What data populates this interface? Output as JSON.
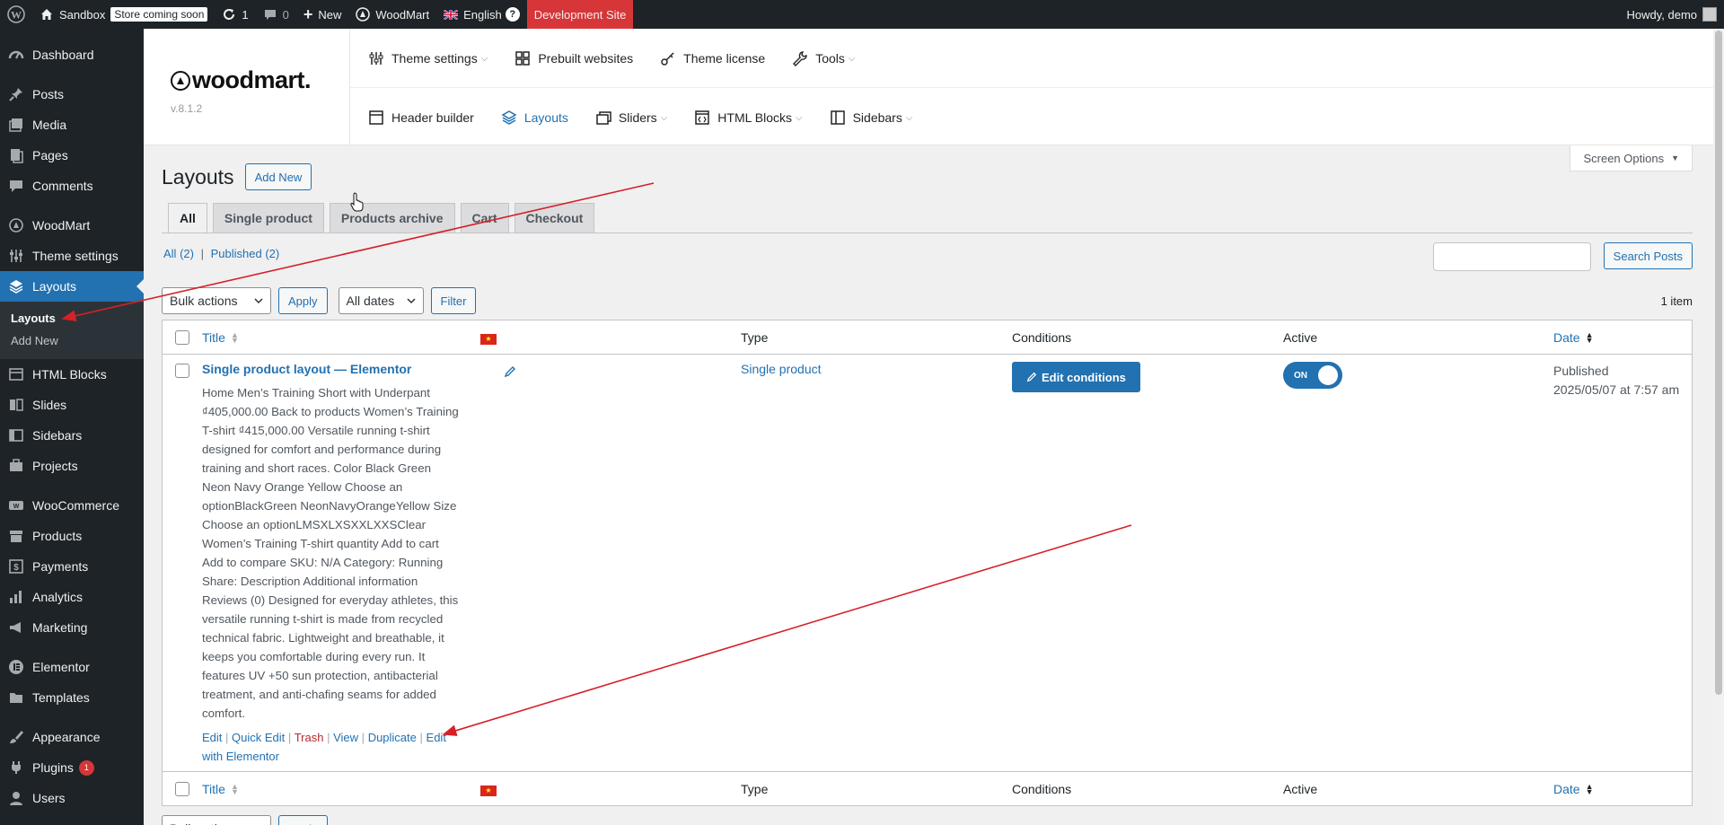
{
  "adminbar": {
    "site_name": "Sandbox",
    "store_badge": "Store coming soon",
    "updates_count": "1",
    "comments_count": "0",
    "new_label": "New",
    "woodmart_label": "WoodMart",
    "language_label": "English",
    "help_label": "?",
    "dev_site_label": "Development Site",
    "howdy_label": "Howdy, demo"
  },
  "sidebar": {
    "items": [
      {
        "label": "Dashboard"
      },
      {
        "label": "Posts"
      },
      {
        "label": "Media"
      },
      {
        "label": "Pages"
      },
      {
        "label": "Comments"
      },
      {
        "label": "WoodMart"
      },
      {
        "label": "Theme settings"
      },
      {
        "label": "Layouts"
      },
      {
        "label": "HTML Blocks"
      },
      {
        "label": "Slides"
      },
      {
        "label": "Sidebars"
      },
      {
        "label": "Projects"
      },
      {
        "label": "WooCommerce"
      },
      {
        "label": "Products"
      },
      {
        "label": "Payments"
      },
      {
        "label": "Analytics"
      },
      {
        "label": "Marketing"
      },
      {
        "label": "Elementor"
      },
      {
        "label": "Templates"
      },
      {
        "label": "Appearance"
      },
      {
        "label": "Plugins"
      },
      {
        "label": "Users"
      }
    ],
    "submenu": {
      "current": "Layouts",
      "add_new": "Add New"
    },
    "plugins_badge": "1"
  },
  "woodmart": {
    "logo_text": "woodmart.",
    "version": "v.8.1.2",
    "nav_row1": [
      {
        "label": "Theme settings"
      },
      {
        "label": "Prebuilt websites"
      },
      {
        "label": "Theme license"
      },
      {
        "label": "Tools"
      }
    ],
    "nav_row2": [
      {
        "label": "Header builder"
      },
      {
        "label": "Layouts"
      },
      {
        "label": "Sliders"
      },
      {
        "label": "HTML Blocks"
      },
      {
        "label": "Sidebars"
      }
    ]
  },
  "page": {
    "screen_options": "Screen Options",
    "title": "Layouts",
    "add_new": "Add New",
    "tabs": [
      {
        "label": "All"
      },
      {
        "label": "Single product"
      },
      {
        "label": "Products archive"
      },
      {
        "label": "Cart"
      },
      {
        "label": "Checkout"
      }
    ],
    "filters": {
      "all": "All",
      "all_count": "(2)",
      "sep": "|",
      "published": "Published",
      "published_count": "(2)"
    },
    "search_button": "Search Posts",
    "bulk_actions": "Bulk actions",
    "apply": "Apply",
    "all_dates": "All dates",
    "filter": "Filter",
    "items_count": "1 item"
  },
  "table": {
    "headers": {
      "title": "Title",
      "type": "Type",
      "conditions": "Conditions",
      "active": "Active",
      "date": "Date"
    },
    "row": {
      "title": "Single product layout",
      "title_suffix": " — Elementor",
      "excerpt": "Home Men’s Training Short with Underpant ₫405,000.00 Back to products Women’s Training T-shirt ₫415,000.00 Versatile running t-shirt designed for comfort and performance during training and short races. Color Black Green Neon Navy Orange Yellow Choose an optionBlackGreen NeonNavyOrangeYellow Size Choose an optionLMSXLXSXXLXXSClear Women’s Training T-shirt quantity Add to cart Add to compare SKU: N/A Category: Running Share: Description Additional information Reviews (0) Designed for everyday athletes, this versatile running t-shirt is made from recycled technical fabric. Lightweight and breathable, it keeps you comfortable during every run. It features UV +50 sun protection, antibacterial treatment, and anti-chafing seams for added comfort.",
      "actions": {
        "edit": "Edit",
        "quick_edit": "Quick Edit",
        "trash": "Trash",
        "view": "View",
        "duplicate": "Duplicate",
        "edit_elementor": "Edit with Elementor",
        "sep": "|"
      },
      "type": "Single product",
      "edit_conditions": "Edit conditions",
      "active_toggle": "ON",
      "date_status": "Published",
      "date_value": "2025/05/07 at 7:57 am"
    }
  },
  "colors": {
    "admin_dark": "#1d2327",
    "wp_blue": "#2271b1",
    "dev_red": "#d63638",
    "annotation_red": "#d62027"
  }
}
